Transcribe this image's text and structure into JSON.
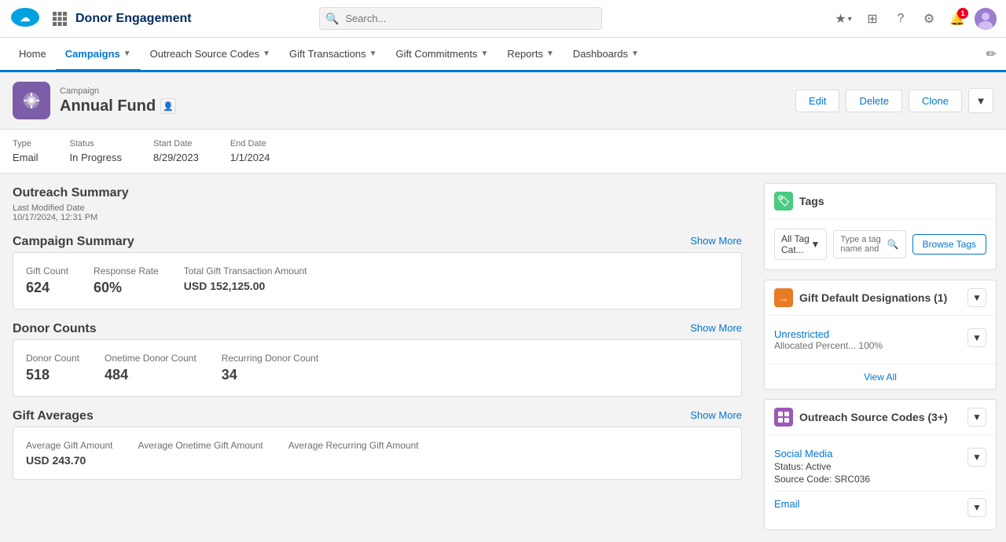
{
  "topNav": {
    "appName": "Donor Engagement",
    "searchPlaceholder": "Search...",
    "notifications": "1"
  },
  "mainNav": {
    "items": [
      {
        "label": "Home",
        "active": false,
        "hasDropdown": false
      },
      {
        "label": "Campaigns",
        "active": true,
        "hasDropdown": true
      },
      {
        "label": "Outreach Source Codes",
        "active": false,
        "hasDropdown": true
      },
      {
        "label": "Gift Transactions",
        "active": false,
        "hasDropdown": true
      },
      {
        "label": "Gift Commitments",
        "active": false,
        "hasDropdown": true
      },
      {
        "label": "Reports",
        "active": false,
        "hasDropdown": true
      },
      {
        "label": "Dashboards",
        "active": false,
        "hasDropdown": true
      }
    ]
  },
  "pageHeader": {
    "breadcrumb": "Campaign",
    "title": "Annual Fund",
    "editBtn": "Edit",
    "deleteBtn": "Delete",
    "cloneBtn": "Clone"
  },
  "recordFields": {
    "type": {
      "label": "Type",
      "value": "Email"
    },
    "status": {
      "label": "Status",
      "value": "In Progress"
    },
    "startDate": {
      "label": "Start Date",
      "value": "8/29/2023"
    },
    "endDate": {
      "label": "End Date",
      "value": "1/1/2024"
    }
  },
  "outreachSummary": {
    "title": "Outreach Summary",
    "lastModifiedLabel": "Last Modified Date",
    "lastModifiedValue": "10/17/2024, 12:31 PM"
  },
  "campaignSummary": {
    "title": "Campaign Summary",
    "showMore": "Show More",
    "giftCountLabel": "Gift Count",
    "giftCountValue": "624",
    "responseRateLabel": "Response Rate",
    "responseRateValue": "60%",
    "totalGiftLabel": "Total Gift Transaction Amount",
    "totalGiftValue": "USD 152,125.00"
  },
  "donorCounts": {
    "title": "Donor Counts",
    "showMore": "Show More",
    "donorCountLabel": "Donor Count",
    "donorCountValue": "518",
    "onetimeLabel": "Onetime Donor Count",
    "onetimeValue": "484",
    "recurringLabel": "Recurring Donor Count",
    "recurringValue": "34"
  },
  "giftAverages": {
    "title": "Gift Averages",
    "showMore": "Show More",
    "avgGiftLabel": "Average Gift Amount",
    "avgGiftValue": "USD 243.70",
    "avgOnetimeLabel": "Average Onetime Gift Amount",
    "avgRecurringLabel": "Average Recurring Gift Amount"
  },
  "tags": {
    "title": "Tags",
    "selectPlaceholder": "All Tag Cat...",
    "inputPlaceholder": "Type a tag name and",
    "browseBtnLabel": "Browse Tags"
  },
  "giftDesignations": {
    "title": "Gift Default Designations (1)",
    "unrestricted": "Unrestricted",
    "allocatedLabel": "Allocated Percent...",
    "allocatedValue": "100%",
    "viewAll": "View All"
  },
  "outreachSourceCodes": {
    "title": "Outreach Source Codes (3+)",
    "socialMedia": {
      "name": "Social Media",
      "statusLabel": "Status:",
      "statusValue": "Active",
      "sourceCodeLabel": "Source Code:",
      "sourceCodeValue": "SRC036"
    },
    "email": {
      "name": "Email"
    }
  }
}
